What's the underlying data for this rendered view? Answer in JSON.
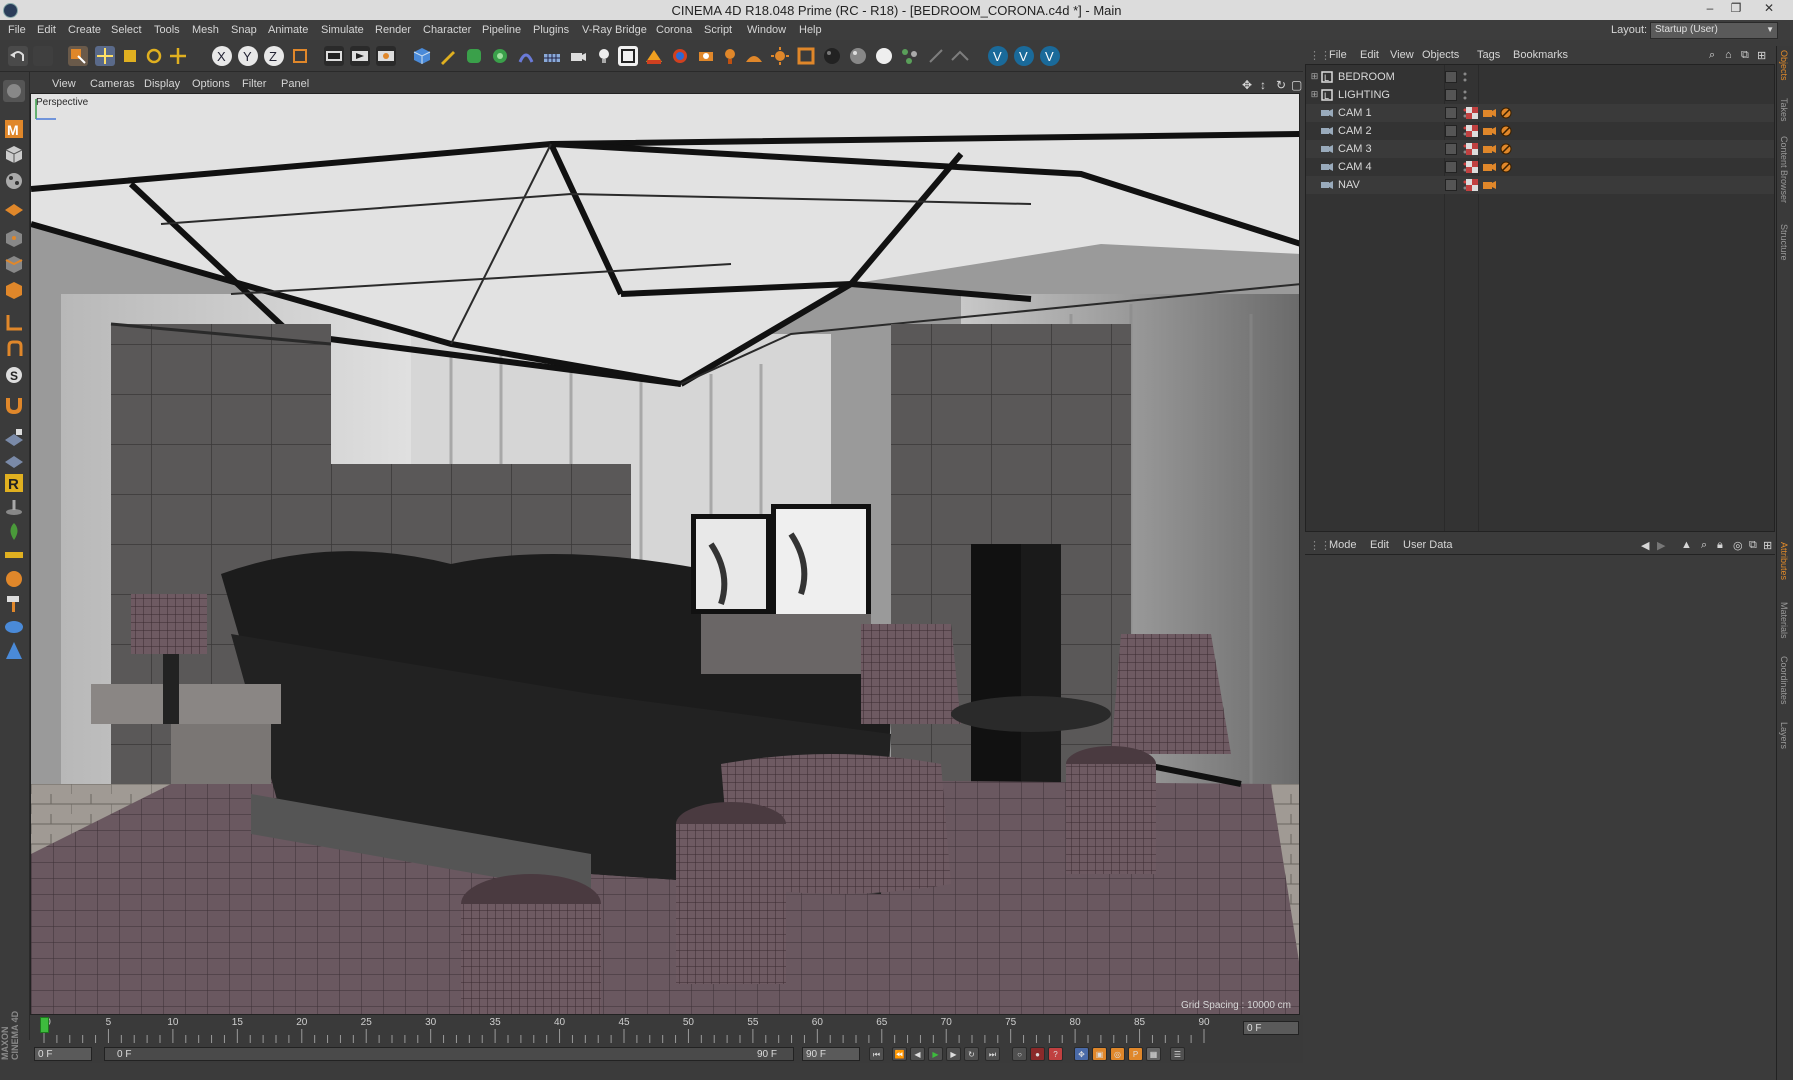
{
  "window": {
    "title": "CINEMA 4D R18.048 Prime (RC - R18) - [BEDROOM_CORONA.c4d *] - Main",
    "controls": {
      "minimize": "–",
      "restore": "❐",
      "close": "✕"
    }
  },
  "menubar": {
    "items": [
      "File",
      "Edit",
      "Create",
      "Select",
      "Tools",
      "Mesh",
      "Snap",
      "Animate",
      "Simulate",
      "Render",
      "Character",
      "Pipeline",
      "Plugins",
      "V-Ray Bridge",
      "Corona",
      "Script",
      "Window",
      "Help"
    ],
    "layout_label": "Layout:",
    "layout_value": "Startup (User)"
  },
  "viewport": {
    "menu": [
      "View",
      "Cameras",
      "Display",
      "Options",
      "Filter",
      "Panel"
    ],
    "label": "Perspective",
    "grid_spacing": "Grid Spacing : 10000 cm"
  },
  "timeline": {
    "ticks": [
      0,
      5,
      10,
      15,
      20,
      25,
      30,
      35,
      40,
      45,
      50,
      55,
      60,
      65,
      70,
      75,
      80,
      85,
      90
    ],
    "current_frame_right": "0 F"
  },
  "transport": {
    "start_frame": "0 F",
    "range_start": "0 F",
    "range_end": "90 F",
    "end_frame": "90 F"
  },
  "logo": "MAXON CINEMA 4D",
  "object_manager": {
    "menu": [
      "File",
      "Edit",
      "View",
      "Objects",
      "Tags",
      "Bookmarks"
    ],
    "objects": [
      {
        "name": "BEDROOM",
        "type": "null-icon",
        "has_tags": false
      },
      {
        "name": "LIGHTING",
        "type": "null-icon",
        "has_tags": false
      },
      {
        "name": "CAM 1",
        "type": "camera-icon",
        "has_tags": true,
        "protect": true
      },
      {
        "name": "CAM 2",
        "type": "camera-icon",
        "has_tags": true,
        "protect": true
      },
      {
        "name": "CAM 3",
        "type": "camera-icon",
        "has_tags": true,
        "protect": true
      },
      {
        "name": "CAM 4",
        "type": "camera-icon",
        "has_tags": true,
        "protect": true
      },
      {
        "name": "NAV",
        "type": "camera-icon",
        "has_tags": true,
        "protect": false
      }
    ]
  },
  "attribute_manager": {
    "menu": [
      "Mode",
      "Edit",
      "User Data"
    ]
  },
  "side_tabs": {
    "top": [
      "Objects",
      "Takes",
      "Content Browser",
      "Structure"
    ],
    "bottom": [
      "Attributes",
      "Materials",
      "Coordinates",
      "Layers"
    ]
  },
  "colors": {
    "accent_orange": "#e0872a",
    "playhead_green": "#3dbb3d",
    "panel_bg": "#333333",
    "ui_bg": "#3b3b3b"
  }
}
